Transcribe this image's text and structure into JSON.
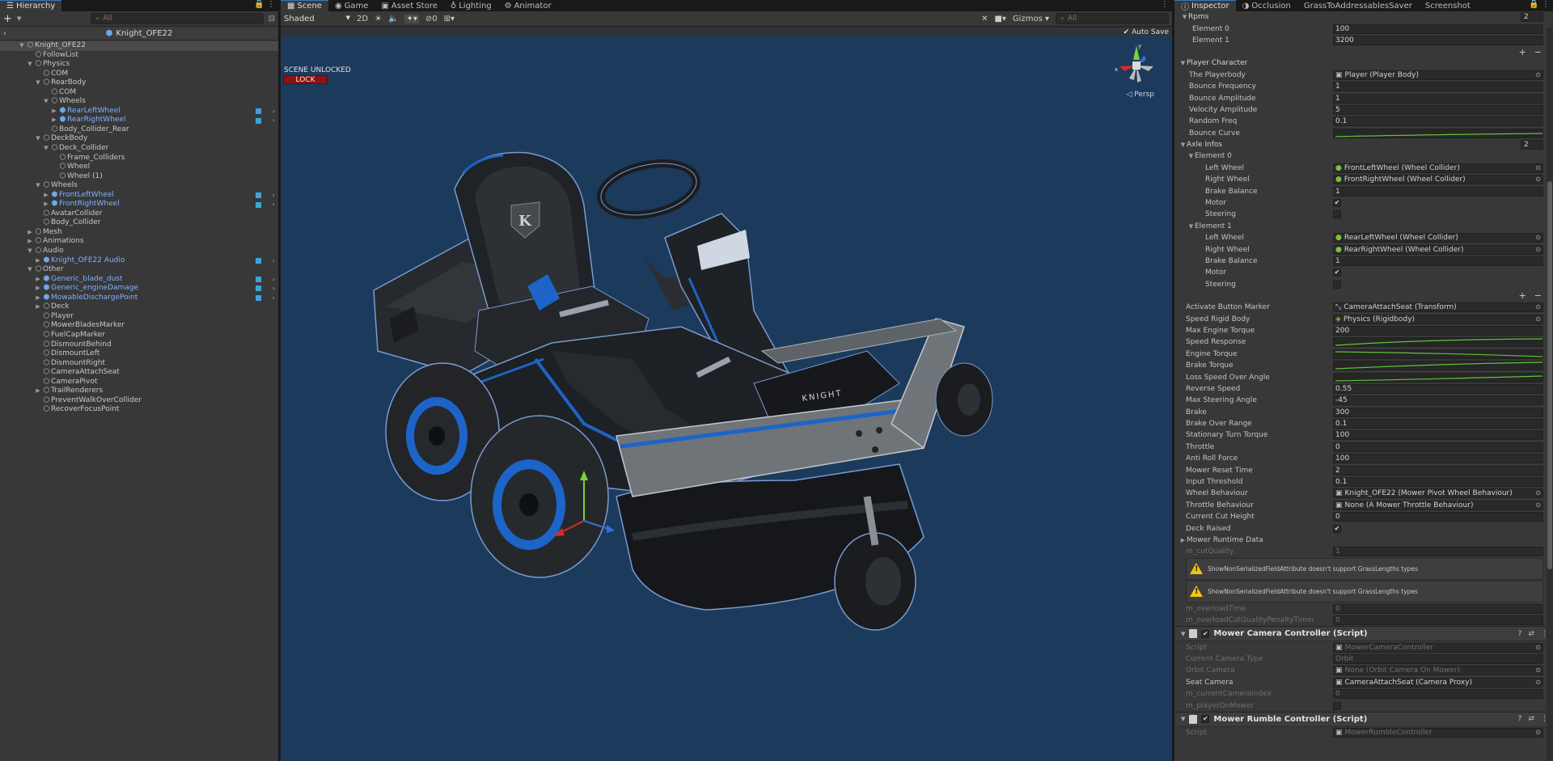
{
  "hierarchy": {
    "tab_label": "Hierarchy",
    "add_label": "+",
    "search_placeholder": "All",
    "breadcrumb": "Knight_OFE22",
    "items": [
      {
        "label": "Knight_OFE22",
        "depth": 0,
        "arrow": "down",
        "prefab": false,
        "selected": true
      },
      {
        "label": "FollowList",
        "depth": 1,
        "arrow": "",
        "prefab": false
      },
      {
        "label": "Physics",
        "depth": 1,
        "arrow": "down",
        "prefab": false
      },
      {
        "label": "COM",
        "depth": 2,
        "arrow": "",
        "prefab": false
      },
      {
        "label": "RearBody",
        "depth": 2,
        "arrow": "down",
        "prefab": false
      },
      {
        "label": "COM",
        "depth": 3,
        "arrow": "",
        "prefab": false
      },
      {
        "label": "Wheels",
        "depth": 3,
        "arrow": "down",
        "prefab": false
      },
      {
        "label": "RearLeftWheel",
        "depth": 4,
        "arrow": "right",
        "prefab": true
      },
      {
        "label": "RearRightWheel",
        "depth": 4,
        "arrow": "right",
        "prefab": true
      },
      {
        "label": "Body_Collider_Rear",
        "depth": 3,
        "arrow": "",
        "prefab": false
      },
      {
        "label": "DeckBody",
        "depth": 2,
        "arrow": "down",
        "prefab": false
      },
      {
        "label": "Deck_Collider",
        "depth": 3,
        "arrow": "down",
        "prefab": false
      },
      {
        "label": "Frame_Colliders",
        "depth": 4,
        "arrow": "",
        "prefab": false
      },
      {
        "label": "Wheel",
        "depth": 4,
        "arrow": "",
        "prefab": false
      },
      {
        "label": "Wheel (1)",
        "depth": 4,
        "arrow": "",
        "prefab": false
      },
      {
        "label": "Wheels",
        "depth": 2,
        "arrow": "down",
        "prefab": false
      },
      {
        "label": "FrontLeftWheel",
        "depth": 3,
        "arrow": "right",
        "prefab": true
      },
      {
        "label": "FrontRightWheel",
        "depth": 3,
        "arrow": "right",
        "prefab": true
      },
      {
        "label": "AvatarCollider",
        "depth": 2,
        "arrow": "",
        "prefab": false
      },
      {
        "label": "Body_Collider",
        "depth": 2,
        "arrow": "",
        "prefab": false
      },
      {
        "label": "Mesh",
        "depth": 1,
        "arrow": "right",
        "prefab": false
      },
      {
        "label": "Animations",
        "depth": 1,
        "arrow": "right",
        "prefab": false
      },
      {
        "label": "Audio",
        "depth": 1,
        "arrow": "down",
        "prefab": false
      },
      {
        "label": "Knight_OFE22 Audio",
        "depth": 2,
        "arrow": "right",
        "prefab": true
      },
      {
        "label": "Other",
        "depth": 1,
        "arrow": "down",
        "prefab": false
      },
      {
        "label": "Generic_blade_dust",
        "depth": 2,
        "arrow": "right",
        "prefab": true
      },
      {
        "label": "Generic_engineDamage",
        "depth": 2,
        "arrow": "right",
        "prefab": true
      },
      {
        "label": "MowableDischargePoint",
        "depth": 2,
        "arrow": "right",
        "prefab": true
      },
      {
        "label": "Deck",
        "depth": 2,
        "arrow": "right",
        "prefab": false
      },
      {
        "label": "Player",
        "depth": 2,
        "arrow": "",
        "prefab": false
      },
      {
        "label": "MowerBladesMarker",
        "depth": 2,
        "arrow": "",
        "prefab": false
      },
      {
        "label": "FuelCapMarker",
        "depth": 2,
        "arrow": "",
        "prefab": false
      },
      {
        "label": "DismountBehind",
        "depth": 2,
        "arrow": "",
        "prefab": false
      },
      {
        "label": "DismountLeft",
        "depth": 2,
        "arrow": "",
        "prefab": false
      },
      {
        "label": "DismountRight",
        "depth": 2,
        "arrow": "",
        "prefab": false
      },
      {
        "label": "CameraAttachSeat",
        "depth": 2,
        "arrow": "",
        "prefab": false
      },
      {
        "label": "CameraPivot",
        "depth": 2,
        "arrow": "",
        "prefab": false
      },
      {
        "label": "TrailRenderers",
        "depth": 2,
        "arrow": "right",
        "prefab": false
      },
      {
        "label": "PreventWalkOverCollider",
        "depth": 2,
        "arrow": "",
        "prefab": false
      },
      {
        "label": "RecoverFocusPoint",
        "depth": 2,
        "arrow": "",
        "prefab": false
      }
    ]
  },
  "scene": {
    "tabs": [
      "Scene",
      "Game",
      "Asset Store",
      "Lighting",
      "Animator"
    ],
    "shading_mode": "Shaded",
    "mode_2d": "2D",
    "hidden_count": "0",
    "gizmos_label": "Gizmos",
    "search_placeholder": "All",
    "auto_save": "Auto Save",
    "status_text": "SCENE UNLOCKED",
    "lock_label": "LOCK",
    "projection": "Persp",
    "axis_x": "x",
    "axis_y": "y",
    "brand_text": "KNIGHT",
    "seat_badge": "K"
  },
  "inspector": {
    "tabs": [
      "Inspector",
      "Occlusion",
      "GrassToAddressablesSaver",
      "Screenshot"
    ],
    "rpms": {
      "label": "Rpms",
      "count": "2",
      "elements": [
        {
          "label": "Element 0",
          "value": "100"
        },
        {
          "label": "Element 1",
          "value": "3200"
        }
      ]
    },
    "player_character": {
      "label": "Player Character",
      "fields": [
        {
          "label": "The Playerbody",
          "value": "Player (Player Body)",
          "type": "obj"
        },
        {
          "label": "Bounce Frequency",
          "value": "1"
        },
        {
          "label": "Bounce Amplitude",
          "value": "1"
        },
        {
          "label": "Velocity Amplitude",
          "value": "5"
        },
        {
          "label": "Random Freq",
          "value": "0.1"
        },
        {
          "label": "Bounce Curve",
          "value": "",
          "type": "curve"
        }
      ]
    },
    "axle_infos": {
      "label": "Axle Infos",
      "count": "2",
      "elements": [
        {
          "label": "Element 0",
          "left": "FrontLeftWheel (Wheel Collider)",
          "right": "FrontRightWheel (Wheel Collider)",
          "brake": "1",
          "motor": true,
          "steering": false
        },
        {
          "label": "Element 1",
          "left": "RearLeftWheel (Wheel Collider)",
          "right": "RearRightWheel (Wheel Collider)",
          "brake": "1",
          "motor": true,
          "steering": false
        }
      ],
      "left_label": "Left Wheel",
      "right_label": "Right Wheel",
      "brake_label": "Brake Balance",
      "motor_label": "Motor",
      "steering_label": "Steering"
    },
    "fields": [
      {
        "label": "Activate Button Marker",
        "value": "CameraAttachSeat (Transform)",
        "type": "obj"
      },
      {
        "label": "Speed Rigid Body",
        "value": "Physics (Rigidbody)",
        "type": "obj"
      },
      {
        "label": "Max Engine Torque",
        "value": "200"
      },
      {
        "label": "Speed Response",
        "value": "",
        "type": "curve"
      },
      {
        "label": "Engine Torque",
        "value": "",
        "type": "curve"
      },
      {
        "label": "Brake Torque",
        "value": "",
        "type": "curve"
      },
      {
        "label": "Loss Speed Over Angle",
        "value": "",
        "type": "curve"
      },
      {
        "label": "Reverse Speed",
        "value": "0.55"
      },
      {
        "label": "Max Steering Angle",
        "value": "-45"
      },
      {
        "label": "Brake",
        "value": "300"
      },
      {
        "label": "Brake Over Range",
        "value": "0.1"
      },
      {
        "label": "Stationary Turn Torque",
        "value": "100"
      },
      {
        "label": "Throttle",
        "value": "0"
      },
      {
        "label": "Anti Roll Force",
        "value": "100"
      },
      {
        "label": "Mower Reset Time",
        "value": "2"
      },
      {
        "label": "Input Threshold",
        "value": "0.1"
      },
      {
        "label": "Wheel Behaviour",
        "value": "Knight_OFE22 (Mower Pivot Wheel Behaviour)",
        "type": "obj"
      },
      {
        "label": "Throttle Behaviour",
        "value": "None (A Mower Throttle Behaviour)",
        "type": "obj"
      },
      {
        "label": "Current Cut Height",
        "value": "0"
      },
      {
        "label": "Deck Raised",
        "value": "",
        "type": "check",
        "checked": true
      }
    ],
    "runtime_label": "Mower Runtime Data",
    "cut_quality": {
      "label": "m_cutQuality",
      "value": "1"
    },
    "warnings": [
      "ShowNonSerializedFieldAttribute doesn't support GrassLengths types",
      "ShowNonSerializedFieldAttribute doesn't support GrassLengths types"
    ],
    "overload": [
      {
        "label": "m_overloadTime",
        "value": "0"
      },
      {
        "label": "m_overloadCutQualityPenaltyTimer",
        "value": "0"
      }
    ],
    "camera_component": {
      "title": "Mower Camera Controller (Script)",
      "fields": [
        {
          "label": "Script",
          "value": "MowerCameraController",
          "type": "obj",
          "disabled": true
        },
        {
          "label": "Current Camera Type",
          "value": "Orbit",
          "disabled": true
        },
        {
          "label": "Orbit Camera",
          "value": "None (Orbit Camera On Mower)",
          "type": "obj",
          "disabled": true
        },
        {
          "label": "Seat Camera",
          "value": "CameraAttachSeat (Camera Proxy)",
          "type": "obj"
        },
        {
          "label": "m_currentCameraIndex",
          "value": "0",
          "disabled": true
        },
        {
          "label": "m_playerOnMower",
          "value": "",
          "type": "check",
          "checked": false,
          "disabled": true
        }
      ]
    },
    "rumble_component": {
      "title": "Mower Rumble Controller (Script)",
      "script_label": "Script",
      "script_value": "MowerRumbleController"
    }
  }
}
